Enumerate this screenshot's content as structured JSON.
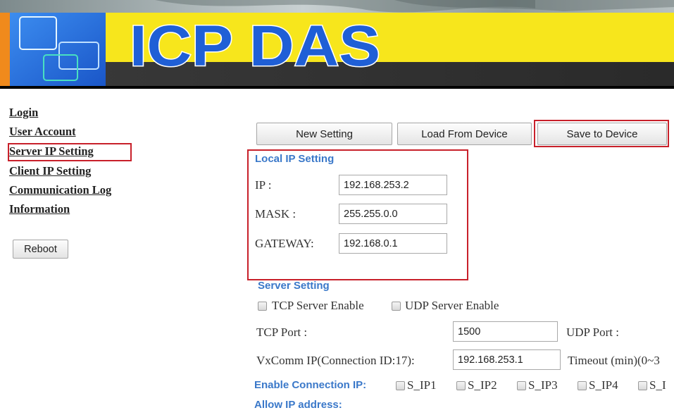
{
  "header": {
    "logo_text": "ICP DAS"
  },
  "sidebar": {
    "items": [
      {
        "label": "Login"
      },
      {
        "label": "User Account"
      },
      {
        "label": "Server IP Setting"
      },
      {
        "label": "Client IP Setting"
      },
      {
        "label": "Communication Log"
      },
      {
        "label": "Information"
      }
    ],
    "reboot_label": "Reboot"
  },
  "toolbar": {
    "new_setting_label": "New Setting",
    "load_label": "Load From Device",
    "save_label": "Save to Device"
  },
  "local_ip": {
    "title": "Local IP Setting",
    "ip_label": "IP :",
    "ip_value": "192.168.253.2",
    "mask_label": "MASK :",
    "mask_value": "255.255.0.0",
    "gateway_label": "GATEWAY:",
    "gateway_value": "192.168.0.1"
  },
  "server": {
    "title": "Server Setting",
    "tcp_enable_label": "TCP Server Enable",
    "tcp_enabled": false,
    "udp_enable_label": "UDP Server Enable",
    "udp_enabled": false,
    "tcp_port_label": "TCP Port :",
    "tcp_port_value": "1500",
    "udp_port_label": "UDP Port :",
    "vxcomm_label": "VxComm IP(Connection ID:17):",
    "vxcomm_value": "192.168.253.1",
    "timeout_label": "Timeout (min)(0~3"
  },
  "connection": {
    "enable_label": "Enable Connection IP:",
    "items": [
      {
        "label": "S_IP1",
        "checked": false
      },
      {
        "label": "S_IP2",
        "checked": false
      },
      {
        "label": "S_IP3",
        "checked": false
      },
      {
        "label": "S_IP4",
        "checked": false
      },
      {
        "label": "S_I",
        "checked": false
      }
    ],
    "allow_label": "Allow IP address:"
  },
  "colors": {
    "highlight_red": "#c8202a",
    "section_blue": "#3a78c9",
    "banner_yellow": "#f7e61c",
    "logo_blue": "#1f5fd6"
  }
}
